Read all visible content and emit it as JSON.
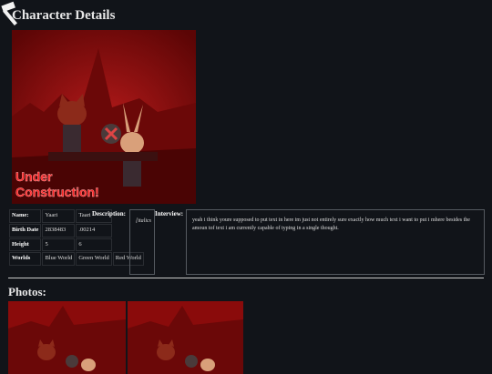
{
  "page": {
    "title": "Character Details",
    "photos_title": "Photos:"
  },
  "banner": {
    "text_line1": "Under",
    "text_line2": "Construction!"
  },
  "info_table": {
    "rows": [
      {
        "label": "Name:",
        "values": [
          "Yaari",
          "Taari"
        ]
      },
      {
        "label": "Birth Date",
        "values": [
          "2838483",
          ".00214"
        ]
      },
      {
        "label": "Height",
        "values": [
          "5",
          "6"
        ]
      },
      {
        "label": "Worlds",
        "values": [
          "Blue World",
          "Green World",
          "Red World"
        ]
      }
    ]
  },
  "description": {
    "label": "Description:",
    "text": "[italics"
  },
  "interview": {
    "label": "Interview:",
    "text": "yeah i think youre supposed to put text in here im just not entirely sure exactly how much text i want to put i mhere besides the amoun tof text i am currently capable of typing in a single thought."
  },
  "colors": {
    "background": "#111419",
    "image_red": "#8a0b0b",
    "banner_text": "#ff2424"
  },
  "icons": [
    "hammer-icon"
  ]
}
